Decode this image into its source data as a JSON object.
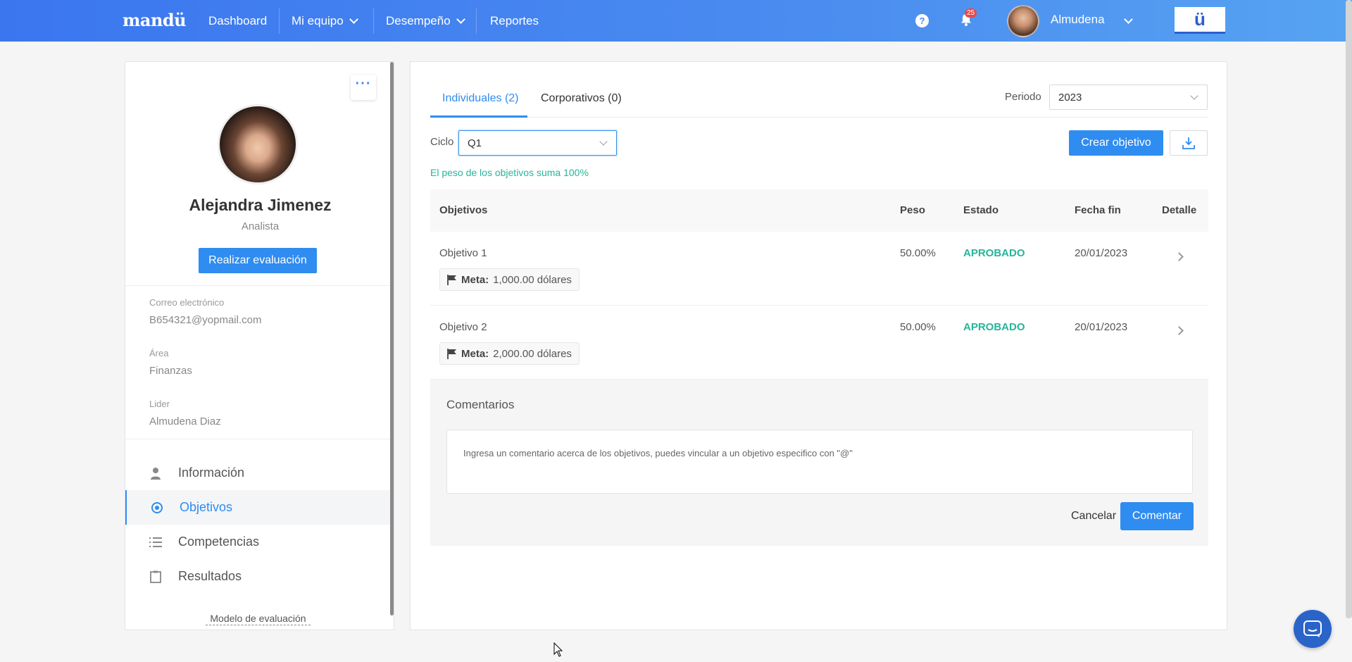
{
  "topnav": {
    "logo": "mandü",
    "items": [
      {
        "label": "Dashboard"
      },
      {
        "label": "Mi equipo"
      },
      {
        "label": "Desempeño"
      },
      {
        "label": "Reportes"
      }
    ],
    "help": "?",
    "notifications_count": "25",
    "user_name": "Almudena",
    "brand_mark": "ü"
  },
  "profile": {
    "more": "···",
    "name": "Alejandra Jimenez",
    "role": "Analista",
    "eval_button": "Realizar evaluación",
    "fields": [
      {
        "label": "Correo electrónico",
        "value": "B654321@yopmail.com"
      },
      {
        "label": "Área",
        "value": "Finanzas"
      },
      {
        "label": "Lider",
        "value": "Almudena Diaz"
      }
    ],
    "menu": [
      {
        "label": "Información",
        "icon": "user-icon"
      },
      {
        "label": "Objetivos",
        "icon": "target-icon"
      },
      {
        "label": "Competencias",
        "icon": "list-icon"
      },
      {
        "label": "Resultados",
        "icon": "clipboard-icon"
      }
    ],
    "model_link": "Modelo de evaluación"
  },
  "main": {
    "tabs": [
      {
        "label": "Individuales (2)"
      },
      {
        "label": "Corporativos (0)"
      }
    ],
    "period_label": "Periodo",
    "period_value": "2023",
    "cycle_label": "Ciclo",
    "cycle_value": "Q1",
    "create_button": "Crear objetivo",
    "weight_note": "El peso de los objetivos suma 100%",
    "table": {
      "headers": [
        "Objetivos",
        "Peso",
        "Estado",
        "Fecha fin",
        "Detalle"
      ],
      "rows": [
        {
          "name": "Objetivo 1",
          "weight": "50.00%",
          "status": "APROBADO",
          "end_date": "20/01/2023",
          "meta_label": "Meta:",
          "meta_value": "1,000.00 dólares"
        },
        {
          "name": "Objetivo 2",
          "weight": "50.00%",
          "status": "APROBADO",
          "end_date": "20/01/2023",
          "meta_label": "Meta:",
          "meta_value": "2,000.00 dólares"
        }
      ]
    },
    "comments": {
      "title": "Comentarios",
      "placeholder": "Ingresa un comentario acerca de los objetivos, puedes vincular a un objetivo especifico con \"@\"",
      "cancel": "Cancelar",
      "submit": "Comentar"
    }
  },
  "colors": {
    "primary": "#2f8cf0",
    "success": "#26b59a",
    "nav_start": "#3b76ef",
    "nav_end": "#57a3f2"
  }
}
